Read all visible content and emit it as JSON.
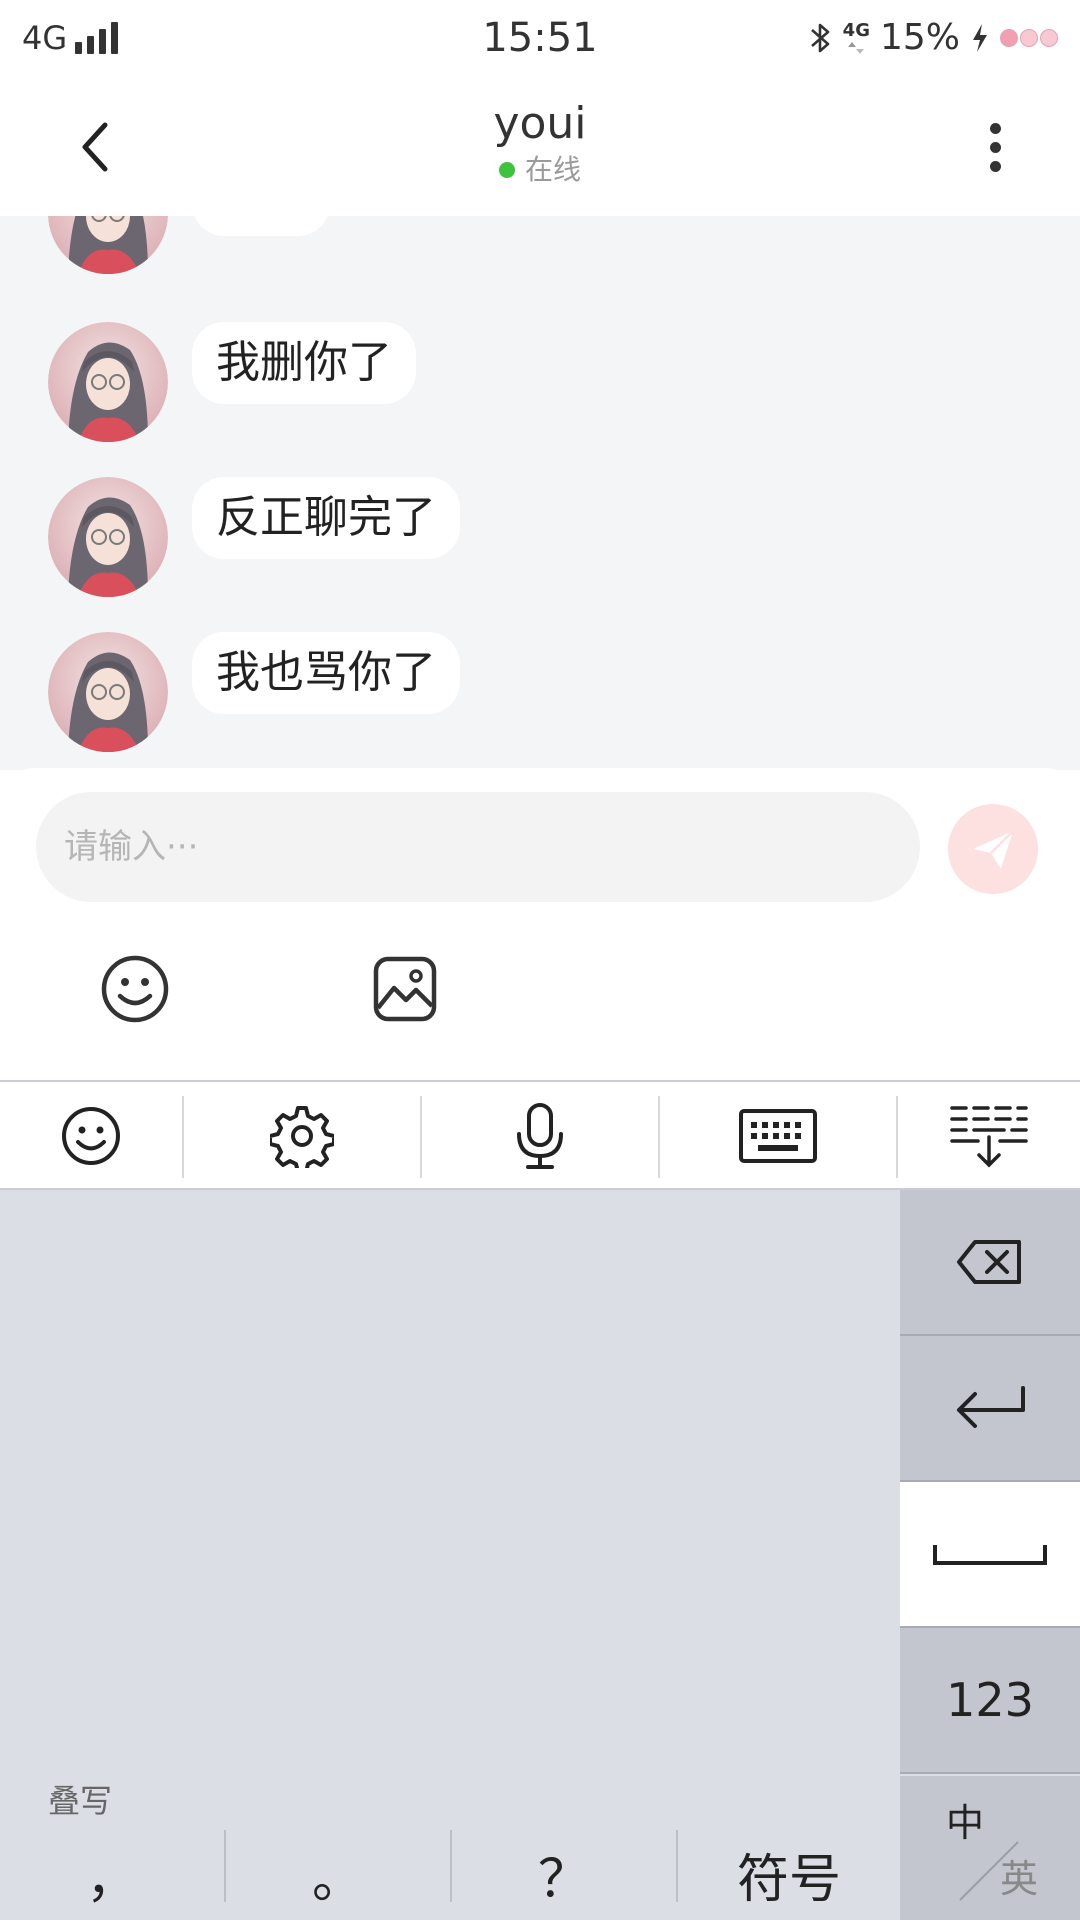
{
  "status_bar": {
    "network": "4G",
    "time": "15:51",
    "network_small": "4G",
    "battery": "15%"
  },
  "header": {
    "title": "youi",
    "status": "在线",
    "status_color": "#3ec33e"
  },
  "messages": [
    {
      "text": ""
    },
    {
      "text": "我删你了"
    },
    {
      "text": "反正聊完了"
    },
    {
      "text": "我也骂你了"
    }
  ],
  "composer": {
    "placeholder": "请输入···",
    "send_color": "#fde0e0"
  },
  "keyboard": {
    "toolbar_icons": [
      "emoji-icon",
      "gear-icon",
      "microphone-icon",
      "keyboard-icon",
      "collapse-keyboard-icon"
    ],
    "side_keys": {
      "delete": "backspace-icon",
      "enter": "return-icon",
      "space": "space-icon",
      "numbers": "123",
      "lang_zh": "中",
      "lang_en": "英"
    },
    "handwrite_label": "叠写",
    "punctuation": [
      "，",
      "。",
      "？",
      "符号"
    ]
  }
}
